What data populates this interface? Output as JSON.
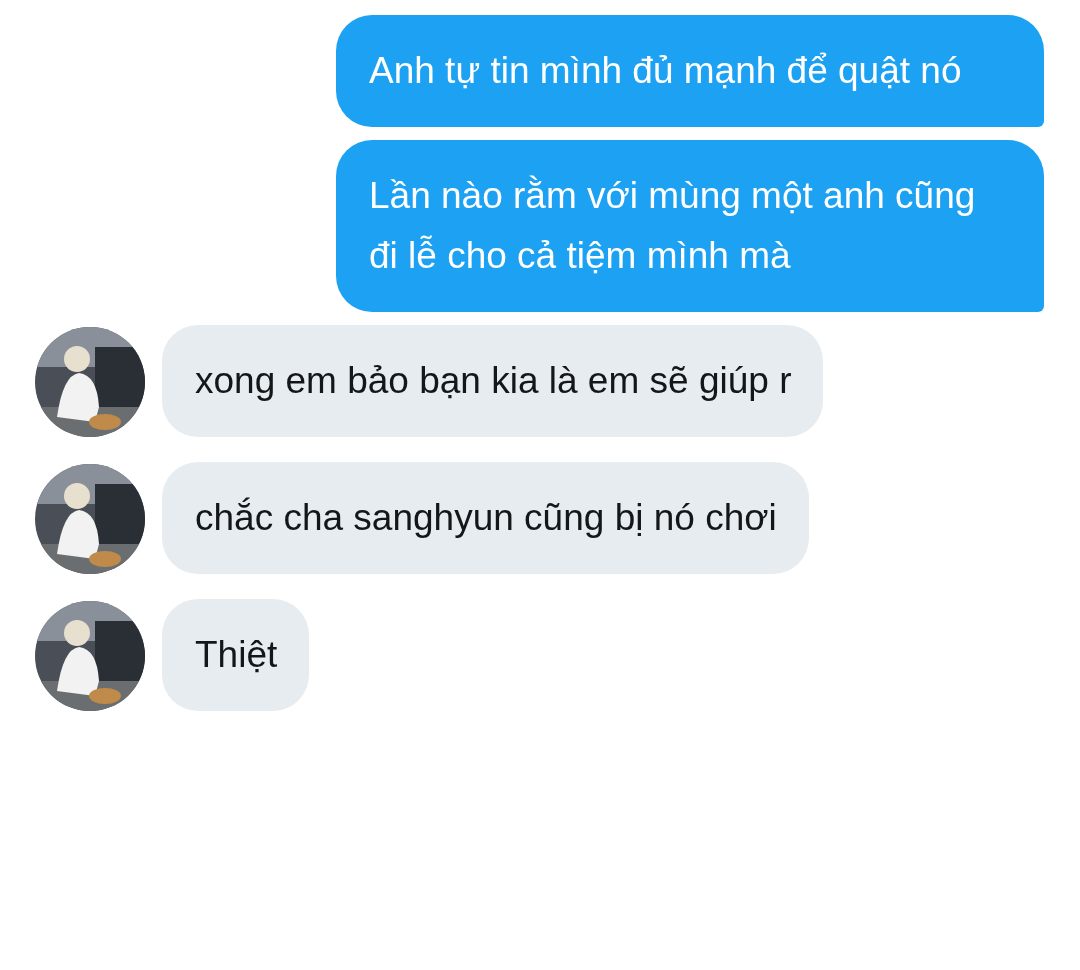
{
  "messages": [
    {
      "kind": "sent",
      "text": "Anh tự tin mình đủ mạnh để quật nó"
    },
    {
      "kind": "sent",
      "text": "Lần nào rằm với mùng một anh cũng đi lễ cho cả tiệm mình mà"
    },
    {
      "kind": "received",
      "text": "xong em bảo bạn kia là em sẽ giúp r"
    },
    {
      "kind": "received",
      "text": "chắc cha sanghyun cũng bị nó chơi"
    },
    {
      "kind": "received",
      "text": "Thiệt"
    }
  ]
}
